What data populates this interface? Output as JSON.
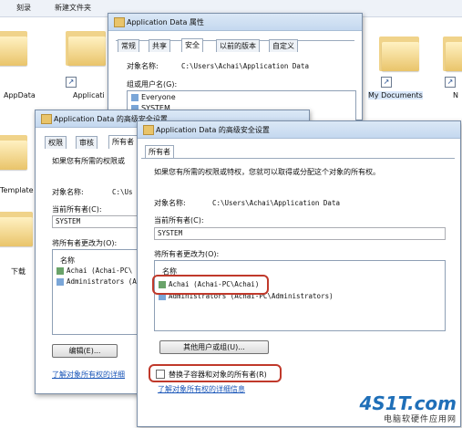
{
  "explorer": {
    "toolbar": [
      "刻录",
      "新建文件夹"
    ],
    "items": [
      "AppData",
      "Applicati",
      "My Documents",
      "N",
      "Template",
      "下载"
    ]
  },
  "props_dialog": {
    "title": "Application Data 属性",
    "tabs": [
      "常规",
      "共享",
      "安全",
      "以前的版本",
      "自定义"
    ],
    "active_tab": "安全",
    "object_name_label": "对象名称:",
    "object_name_value": "C:\\Users\\Achai\\Application Data",
    "group_label": "组或用户名(G):",
    "groups": [
      "Everyone",
      "SYSTEM"
    ]
  },
  "adv_dialog_back": {
    "title": "Application Data 的高级安全设置",
    "tabs": [
      "权限",
      "审核",
      "所有者"
    ],
    "desc": "如果您有所需的权限或",
    "object_name_label": "对象名称:",
    "object_name_value": "C:\\Us",
    "current_owner_label": "当前所有者(C):",
    "current_owner_value": "SYSTEM",
    "change_owner_label": "将所有者更改为(O):",
    "list_header": "名称",
    "list_items": [
      "Achai (Achai-PC\\",
      "Administrators (A"
    ],
    "edit_button": "编辑(E)...",
    "link": "了解对象所有权的详细"
  },
  "adv_dialog_front": {
    "title": "Application Data 的高级安全设置",
    "tab": "所有者",
    "desc": "如果您有所需的权限或特权，您就可以取得或分配这个对象的所有权。",
    "object_name_label": "对象名称:",
    "object_name_value": "C:\\Users\\Achai\\Application Data",
    "current_owner_label": "当前所有者(C):",
    "current_owner_value": "SYSTEM",
    "change_owner_label": "将所有者更改为(O):",
    "list_header": "名称",
    "list_items": [
      "Achai (Achai-PC\\Achai)",
      "Administrators (Achai-PC\\Administrators)"
    ],
    "other_button": "其他用户或组(U)...",
    "checkbox_label": "替换子容器和对象的所有者(R)",
    "link": "了解对象所有权的详细信息"
  },
  "watermark": {
    "logo": "4S1T.com",
    "caption": "电脑软硬件应用网"
  },
  "colors": {
    "highlight": "#c0392b",
    "title_bar": "#c4d8ef",
    "link": "#1a56b8"
  }
}
